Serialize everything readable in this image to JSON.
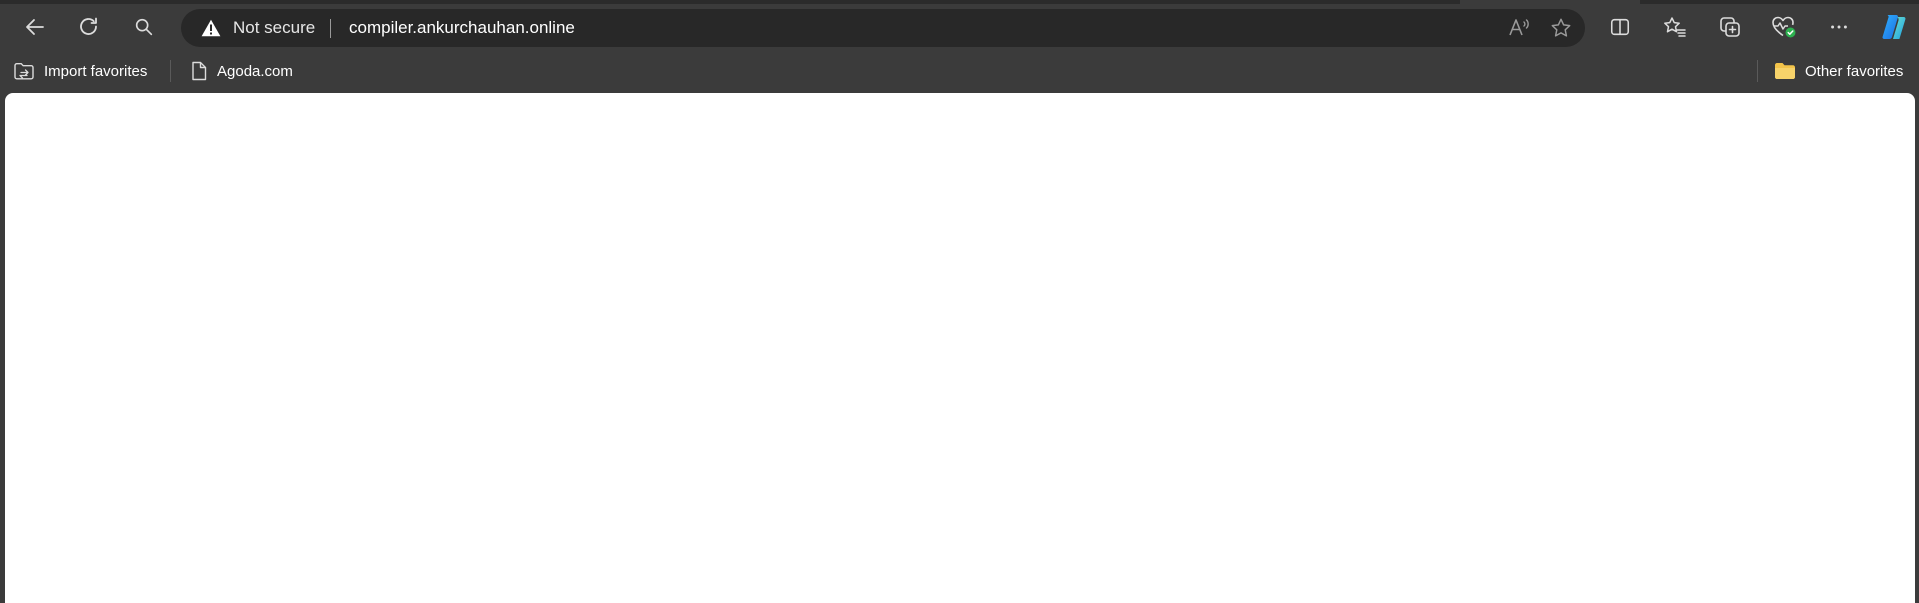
{
  "toolbar": {
    "back_icon": "back-arrow-icon",
    "refresh_icon": "refresh-icon",
    "search_icon": "search-icon"
  },
  "address_bar": {
    "security_label": "Not secure",
    "url": "compiler.ankurchauhan.online",
    "security_icon": "warning-triangle-icon"
  },
  "favorites_bar": {
    "items": [
      {
        "label": "Import favorites",
        "icon": "import-favorites-icon"
      },
      {
        "label": "Agoda.com",
        "icon": "page-icon"
      }
    ],
    "other": {
      "label": "Other favorites",
      "icon": "folder-icon"
    }
  },
  "colors": {
    "chrome_bg": "#3b3b3b",
    "address_bg": "#282828",
    "page_bg": "#ffffff",
    "folder": "#f3c44a",
    "accent_green": "#2db04f"
  }
}
